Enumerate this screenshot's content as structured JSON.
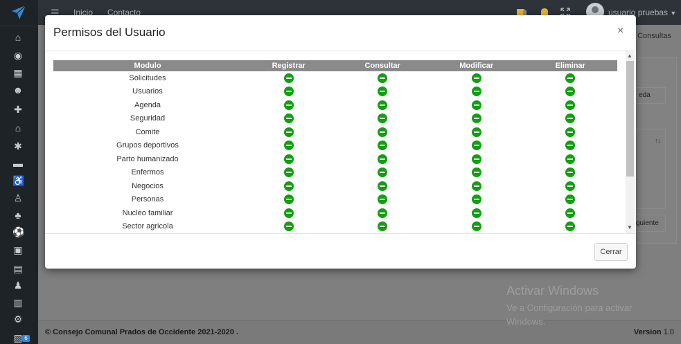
{
  "topbar": {
    "nav": [
      "Inicio",
      "Contacto"
    ],
    "user_name": "usuario pruebas"
  },
  "sidebar": {
    "badge_count": "6",
    "icons": [
      "bank-icon",
      "user-circle-icon",
      "calendar-icon",
      "users-icon",
      "user-plus-icon",
      "home-icon",
      "bug-icon",
      "ambulance-icon",
      "wheelchair-icon",
      "child-icon",
      "tree-icon",
      "soccer-ball-icon",
      "hospital-icon",
      "building-icon",
      "user-icon",
      "document-icon",
      "gear-icon",
      "pdf-icon"
    ]
  },
  "background": {
    "breadcrumb": "/ Consultas",
    "search_button_fragment": "eda",
    "sort_icon": "↑↓",
    "next_button_fragment": "guiente"
  },
  "modal": {
    "title": "Permisos del Usuario",
    "close_label": "×",
    "close_button": "Cerrar",
    "headers": [
      "Modulo",
      "Registrar",
      "Consultar",
      "Modificar",
      "Eliminar"
    ],
    "rows": [
      {
        "module": "Solicitudes"
      },
      {
        "module": "Usuarios"
      },
      {
        "module": "Agenda"
      },
      {
        "module": "Seguridad"
      },
      {
        "module": "Comite"
      },
      {
        "module": "Grupos deportivos"
      },
      {
        "module": "Parto humanizado"
      },
      {
        "module": "Enfermos"
      },
      {
        "module": "Negocios"
      },
      {
        "module": "Personas"
      },
      {
        "module": "Nucleo familiar"
      },
      {
        "module": "Sector agricola"
      }
    ],
    "permission_icon": "minus-circle-icon",
    "permission_color": "#10a010"
  },
  "footer": {
    "copyright": "© Consejo Comunal Prados de Occidente 2021-2020 .",
    "version_label": "Version",
    "version_number": "1.0"
  },
  "watermark": {
    "title": "Activar Windows",
    "subtitle": "Ve a Configuración para activar Windows."
  }
}
